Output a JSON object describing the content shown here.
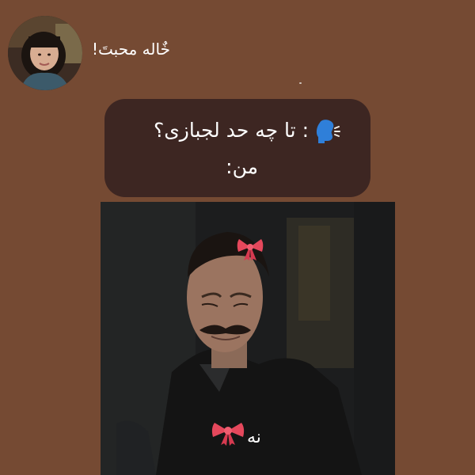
{
  "post": {
    "username": "خٌاله محبتَ!",
    "dot": "."
  },
  "bubble": {
    "line1": ": تا چه حد لجبازی؟",
    "line2": "من:"
  },
  "photo": {
    "caption": "نه"
  },
  "icons": {
    "avatar": "avatar-photo",
    "speaking": "speaking-head-icon",
    "bow": "ribbon-bow-icon"
  },
  "colors": {
    "background": "#754a33",
    "bubble": "#3d2622",
    "text": "#ffffff"
  }
}
